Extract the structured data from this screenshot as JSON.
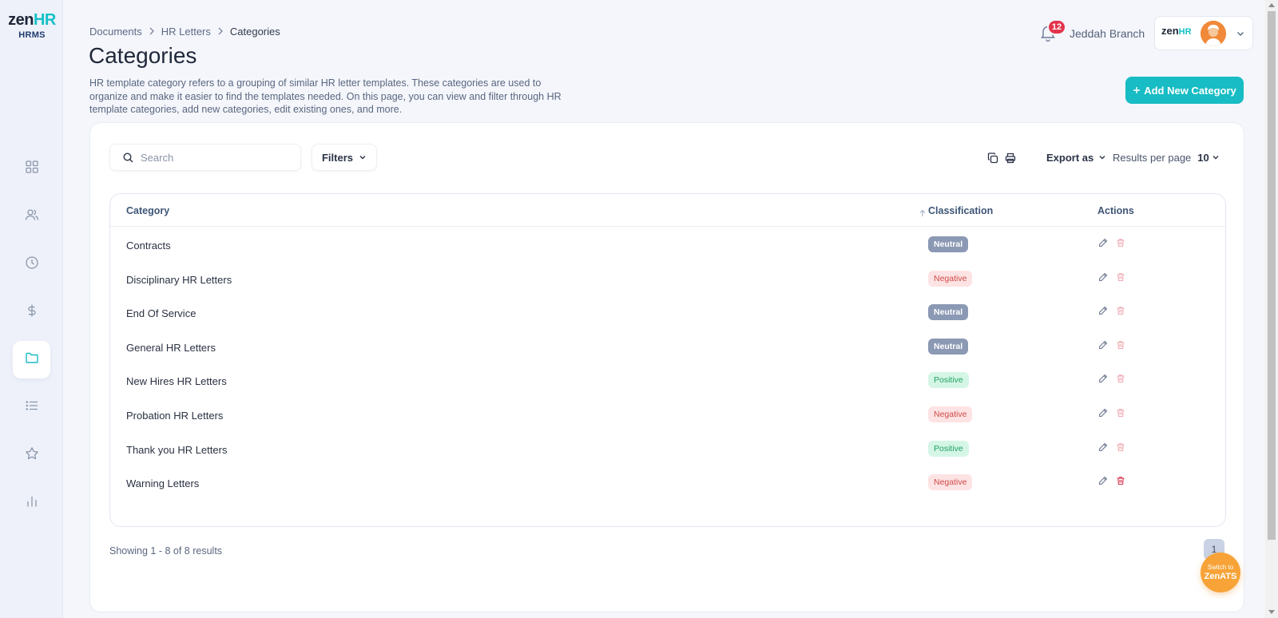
{
  "brand": {
    "zen": "zen",
    "hr": "HR",
    "sub": "HRMS"
  },
  "sidebar": {
    "items": [
      {
        "name": "dashboard",
        "icon": "grid-icon"
      },
      {
        "name": "employees",
        "icon": "users-icon"
      },
      {
        "name": "attendance",
        "icon": "clock-icon"
      },
      {
        "name": "payroll",
        "icon": "dollar-icon"
      },
      {
        "name": "documents",
        "icon": "folder-icon",
        "active": true
      },
      {
        "name": "lists",
        "icon": "list-icon"
      },
      {
        "name": "performance",
        "icon": "star-icon"
      },
      {
        "name": "reports",
        "icon": "bar-chart-icon"
      }
    ]
  },
  "breadcrumb": {
    "items": [
      "Documents",
      "HR Letters"
    ],
    "current": "Categories"
  },
  "header": {
    "title": "Categories",
    "description": "HR template category refers to a grouping of similar HR letter templates. These categories are used to organize and make it easier to find the templates needed. On this page, you can view and filter through HR template categories, add new categories, edit existing ones, and more.",
    "notifications_count": "12",
    "branch": "Jeddah Branch",
    "account_logo_zen": "zen",
    "account_logo_hr": "HR"
  },
  "actions": {
    "add_category": "Add New Category"
  },
  "toolbar": {
    "search_placeholder": "Search",
    "filters": "Filters",
    "export": "Export as",
    "results_per_page_label": "Results per page",
    "results_per_page_value": "10"
  },
  "table": {
    "columns": {
      "category": "Category",
      "classification": "Classification",
      "actions": "Actions"
    },
    "rows": [
      {
        "category": "Contracts",
        "classification": "Neutral"
      },
      {
        "category": "Disciplinary HR Letters",
        "classification": "Negative"
      },
      {
        "category": "End Of Service",
        "classification": "Neutral"
      },
      {
        "category": "General HR Letters",
        "classification": "Neutral"
      },
      {
        "category": "New Hires HR Letters",
        "classification": "Positive"
      },
      {
        "category": "Probation HR Letters",
        "classification": "Negative"
      },
      {
        "category": "Thank you HR Letters",
        "classification": "Positive"
      },
      {
        "category": "Warning Letters",
        "classification": "Negative"
      }
    ]
  },
  "pagination": {
    "showing": "Showing 1 - 8 of 8 results",
    "current_page": "1"
  },
  "switch_app": {
    "line1": "Switch to",
    "line2": "ZenATS"
  },
  "colors": {
    "accent": "#18bcc4",
    "badge_neutral": "#8b99b4",
    "badge_negative_text": "#d04a4a",
    "badge_positive_text": "#23a267",
    "notification": "#e3344b",
    "switch": "#f7a338"
  }
}
